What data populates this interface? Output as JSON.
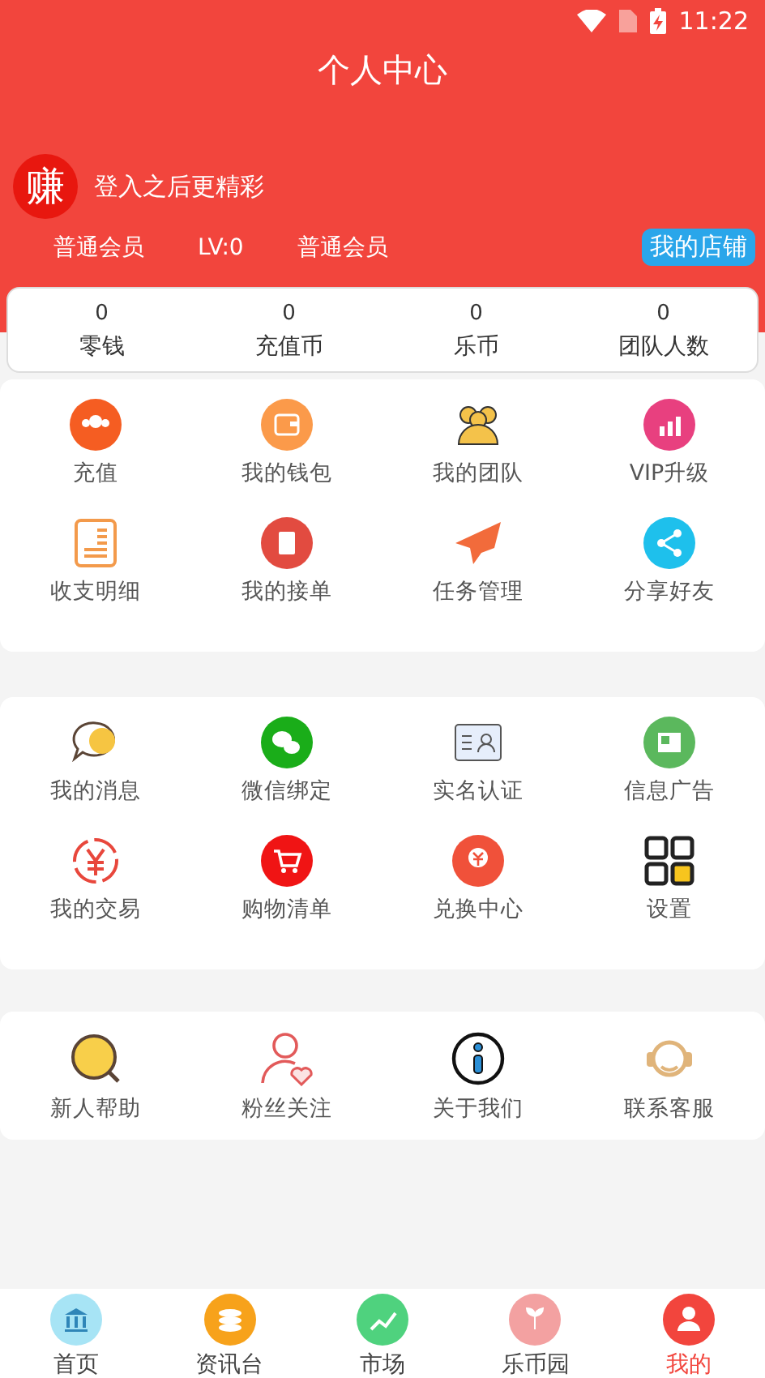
{
  "status_bar": {
    "time": "11:22"
  },
  "header": {
    "title": "个人中心"
  },
  "profile": {
    "avatar_text": "赚",
    "login_prompt": "登入之后更精彩",
    "member_type": "普通会员",
    "level": "LV:0",
    "member_group": "普通会员",
    "shop_button": "我的店铺"
  },
  "stats": [
    {
      "value": "0",
      "label": "零钱"
    },
    {
      "value": "0",
      "label": "充值币"
    },
    {
      "value": "0",
      "label": "乐币"
    },
    {
      "value": "0",
      "label": "团队人数"
    }
  ],
  "sections": [
    {
      "items": [
        "充值",
        "我的钱包",
        "我的团队",
        "VIP升级",
        "收支明细",
        "我的接单",
        "任务管理",
        "分享好友"
      ]
    },
    {
      "items": [
        "我的消息",
        "微信绑定",
        "实名认证",
        "信息广告",
        "我的交易",
        "购物清单",
        "兑换中心",
        "设置"
      ]
    },
    {
      "items": [
        "新人帮助",
        "粉丝关注",
        "关于我们",
        "联系客服"
      ]
    }
  ],
  "bottom_nav": [
    {
      "label": "首页",
      "selected": false
    },
    {
      "label": "资讯台",
      "selected": false
    },
    {
      "label": "市场",
      "selected": false
    },
    {
      "label": "乐币园",
      "selected": false
    },
    {
      "label": "我的",
      "selected": true
    }
  ]
}
